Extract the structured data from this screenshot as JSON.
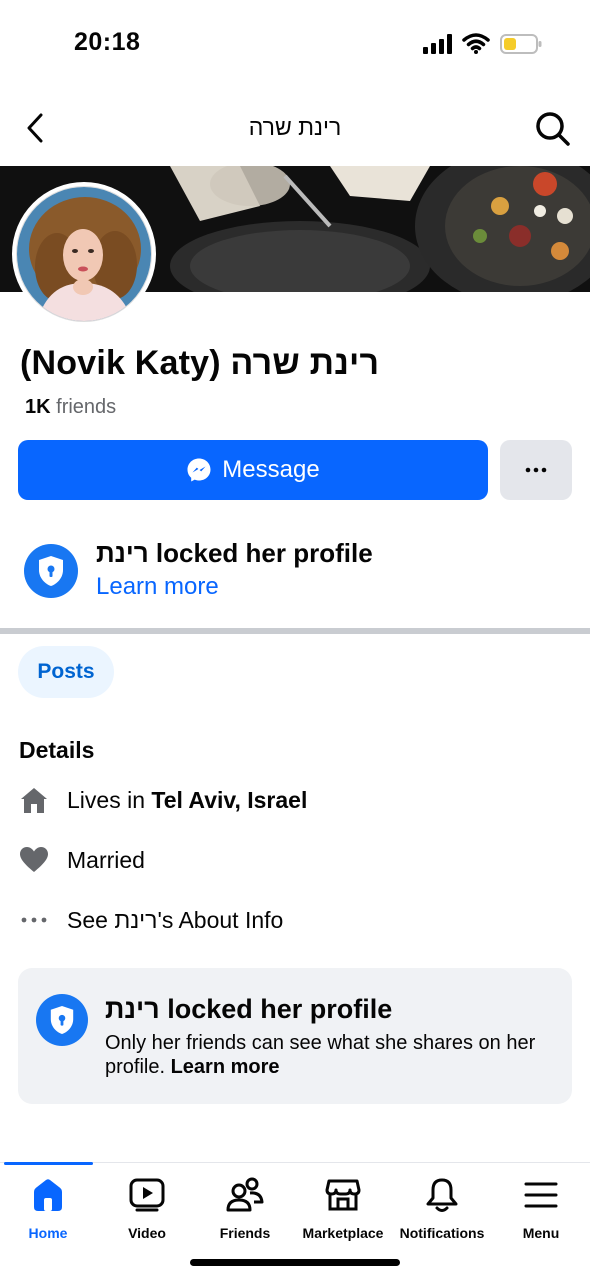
{
  "status_bar": {
    "time": "20:18"
  },
  "header": {
    "title": "רינת שרה"
  },
  "profile": {
    "name": "(Novik Katy) רינת שרה",
    "friends_count": "1K",
    "friends_label": "friends"
  },
  "actions": {
    "message_label": "Message",
    "more_label": "···"
  },
  "lock_notice": {
    "title": "רינת locked her profile",
    "link": "Learn more"
  },
  "tabs_chip": {
    "posts_label": "Posts"
  },
  "details": {
    "heading": "Details",
    "lives_prefix": "Lives in ",
    "lives_city": "Tel Aviv, Israel",
    "relationship": "Married",
    "about_info": "See רינת's About Info"
  },
  "locked_card": {
    "title": "רינת locked her profile",
    "description": "Only her friends can see what she shares on her profile. ",
    "link": "Learn more"
  },
  "bottom_nav": {
    "items": [
      {
        "label": "Home",
        "icon": "home-icon",
        "active": true
      },
      {
        "label": "Video",
        "icon": "video-icon",
        "active": false
      },
      {
        "label": "Friends",
        "icon": "friends-icon",
        "active": false
      },
      {
        "label": "Marketplace",
        "icon": "marketplace-icon",
        "active": false
      },
      {
        "label": "Notifications",
        "icon": "bell-icon",
        "active": false
      },
      {
        "label": "Menu",
        "icon": "menu-icon",
        "active": false
      }
    ]
  },
  "colors": {
    "accent": "#0866ff",
    "lock_badge": "#1877f2",
    "chip_bg": "#ebf5ff",
    "card_bg": "#f0f2f5"
  }
}
